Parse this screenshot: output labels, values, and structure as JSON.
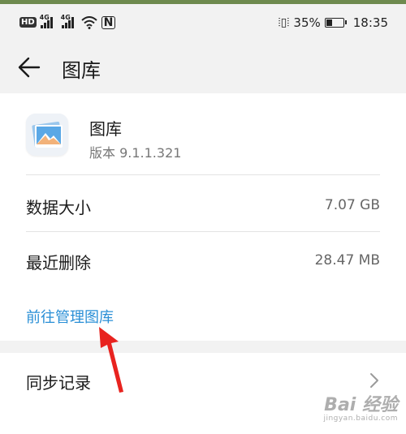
{
  "status_bar": {
    "hd": "HD",
    "network_1": "4G",
    "network_2": "4G",
    "nfc": "N",
    "battery_percent": "35%",
    "battery_level": 0.35,
    "time": "18:35"
  },
  "header": {
    "title": "图库"
  },
  "app": {
    "name": "图库",
    "version": "版本 9.1.1.321"
  },
  "storage": {
    "data_size_label": "数据大小",
    "data_size_value": "7.07 GB",
    "recently_deleted_label": "最近删除",
    "recently_deleted_value": "28.47 MB"
  },
  "link": {
    "manage_label": "前往管理图库"
  },
  "sync": {
    "label": "同步记录"
  },
  "watermark": {
    "main": "Bai 经验",
    "sub": "jingyan.baidu.com"
  },
  "colors": {
    "link": "#2a8fd6",
    "annotation_arrow": "#e8231f",
    "background": "#f2f2f2",
    "card": "#ffffff"
  },
  "icons": {
    "back": "arrow-left-icon",
    "chevron": "chevron-right-icon",
    "app": "gallery-app-icon"
  }
}
